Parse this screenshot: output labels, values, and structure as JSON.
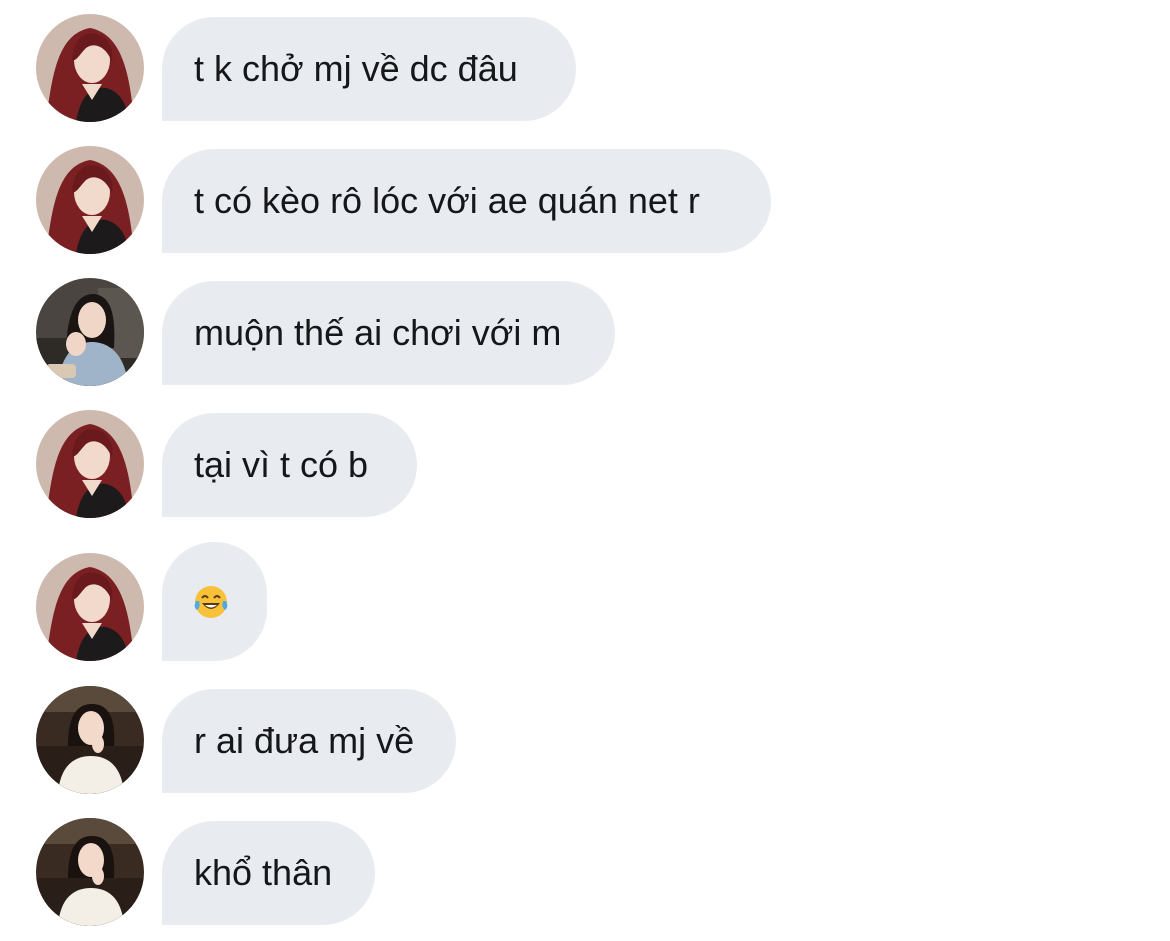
{
  "avatars": {
    "redhair": {
      "name": "red-hair-avatar",
      "bg": "#c9b7ad",
      "hair": "#7a1f22",
      "skin": "#f1d9cc",
      "cloth": "#1c1a1a"
    },
    "hoodie": {
      "name": "sweater-avatar",
      "bg": "#3c3a36",
      "hair": "#1a1512",
      "skin": "#efd6c6",
      "cloth": "#9fb4c8"
    },
    "restaurant": {
      "name": "restaurant-avatar",
      "bg": "#3a2b22",
      "hair": "#1a120e",
      "skin": "#f3d9c9",
      "cloth": "#f4efe6"
    }
  },
  "messages": [
    {
      "avatar": "redhair",
      "text": "t k chở mj về dc đâu"
    },
    {
      "avatar": "redhair",
      "text": "t có kèo rô lóc với ae quán net r"
    },
    {
      "avatar": "hoodie",
      "text": "muộn thế ai chơi với m"
    },
    {
      "avatar": "redhair",
      "text": "tại vì t có b"
    },
    {
      "avatar": "redhair",
      "emoji": "face-with-tears-of-joy"
    },
    {
      "avatar": "restaurant",
      "text": "r ai đưa mj về"
    },
    {
      "avatar": "restaurant",
      "text": "khổ thân"
    }
  ],
  "colors": {
    "bubble_bg": "#e8ecf0",
    "text": "#15171a",
    "background": "#ffffff"
  }
}
